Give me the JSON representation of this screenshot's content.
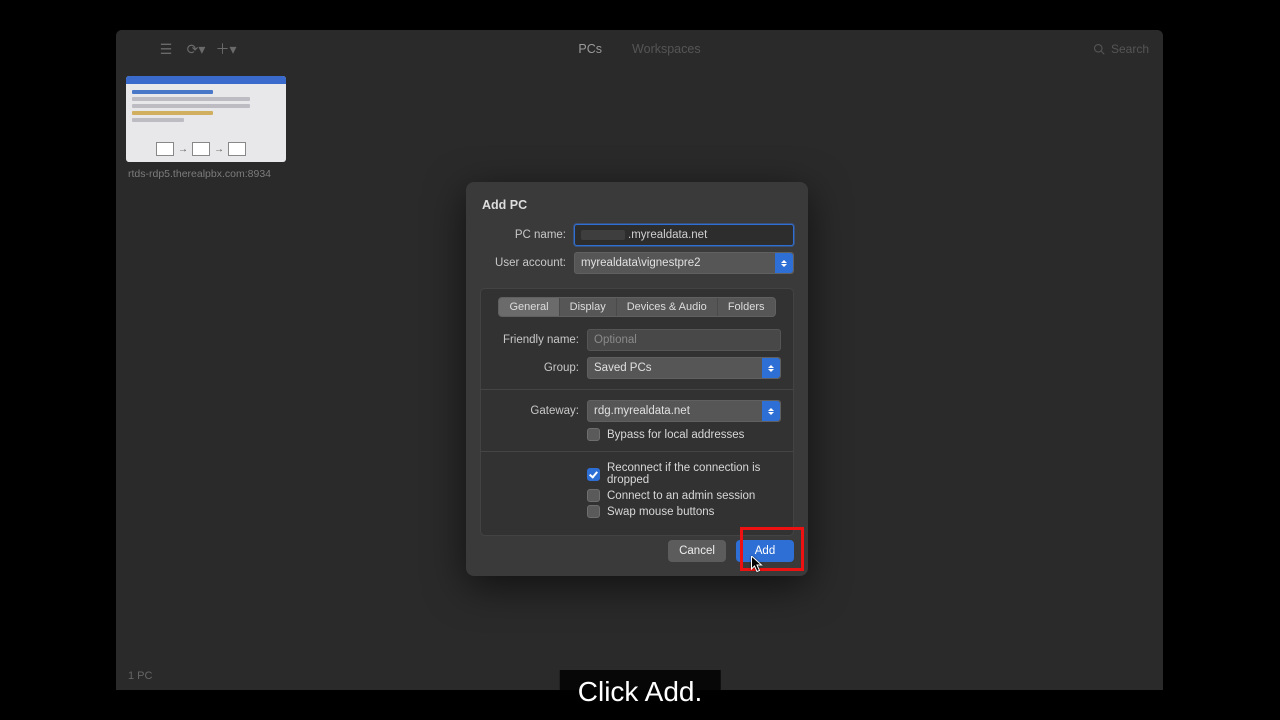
{
  "toolbar": {
    "tabs": {
      "pcs": "PCs",
      "workspaces": "Workspaces"
    },
    "search_placeholder": "Search"
  },
  "thumbnail": {
    "label": "rtds-rdp5.therealpbx.com:8934",
    "sublabel": ""
  },
  "footer": {
    "count": "1 PC"
  },
  "dialog": {
    "title": "Add PC",
    "pc_name_label": "PC name:",
    "pc_name_value": ".myrealdata.net",
    "user_label": "User account:",
    "user_value": "myrealdata\\vignestpre2",
    "tabs": {
      "general": "General",
      "display": "Display",
      "devices": "Devices & Audio",
      "folders": "Folders"
    },
    "friendly_label": "Friendly name:",
    "friendly_placeholder": "Optional",
    "group_label": "Group:",
    "group_value": "Saved PCs",
    "gateway_label": "Gateway:",
    "gateway_value": "rdg.myrealdata.net",
    "bypass_label": "Bypass for local addresses",
    "reconnect_label": "Reconnect if the connection is dropped",
    "admin_label": "Connect to an admin session",
    "swap_label": "Swap mouse buttons",
    "cancel": "Cancel",
    "add": "Add",
    "checks": {
      "bypass": false,
      "reconnect": true,
      "admin": false,
      "swap": false
    }
  },
  "caption": "Click Add."
}
